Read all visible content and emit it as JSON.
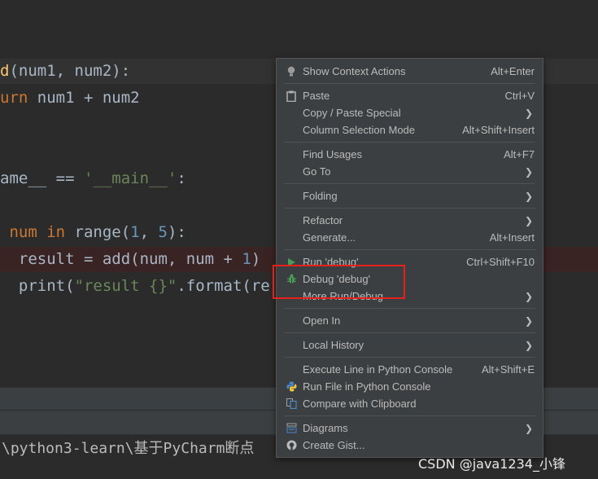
{
  "code": {
    "line1": [
      "d",
      "(num1, num2):"
    ],
    "line2": [
      "urn",
      " num1 + num2"
    ],
    "line3": [
      "ame__ == ",
      "'__main__'",
      ":"
    ],
    "line4": [
      " num ",
      "in",
      " range(",
      "1",
      ", ",
      "5",
      "):"
    ],
    "line5": [
      "  result = add(num, num + ",
      "1",
      ")"
    ],
    "line6": [
      "  print(",
      "\"result {}\"",
      ".format(re"
    ]
  },
  "path_bar": {
    "text": "\\python3-learn\\基于PyCharm断点"
  },
  "watermark": "CSDN @java1234_小锋",
  "menu": {
    "show_context_actions": {
      "label": "Show Context Actions",
      "shortcut": "Alt+Enter"
    },
    "paste": {
      "label": "Paste",
      "shortcut": "Ctrl+V"
    },
    "copy_paste_special": {
      "label": "Copy / Paste Special"
    },
    "column_selection_mode": {
      "label": "Column Selection Mode",
      "shortcut": "Alt+Shift+Insert"
    },
    "find_usages": {
      "label": "Find Usages",
      "shortcut": "Alt+F7"
    },
    "go_to": {
      "label": "Go To"
    },
    "folding": {
      "label": "Folding"
    },
    "refactor": {
      "label": "Refactor"
    },
    "generate": {
      "label": "Generate...",
      "shortcut": "Alt+Insert"
    },
    "run_debug": {
      "label": "Run 'debug'",
      "shortcut": "Ctrl+Shift+F10"
    },
    "debug_debug": {
      "label": "Debug 'debug'"
    },
    "more_run_debug": {
      "label": "More Run/Debug"
    },
    "open_in": {
      "label": "Open In"
    },
    "local_history": {
      "label": "Local History"
    },
    "execute_line": {
      "label": "Execute Line in Python Console",
      "shortcut": "Alt+Shift+E"
    },
    "run_file_console": {
      "label": "Run File in Python Console"
    },
    "compare_clipboard": {
      "label": "Compare with Clipboard"
    },
    "diagrams": {
      "label": "Diagrams"
    },
    "create_gist": {
      "label": "Create Gist..."
    }
  },
  "colors": {
    "highlight_box": "#e8201c",
    "run_icon": "#499c54",
    "debug_icon": "#499c54"
  }
}
